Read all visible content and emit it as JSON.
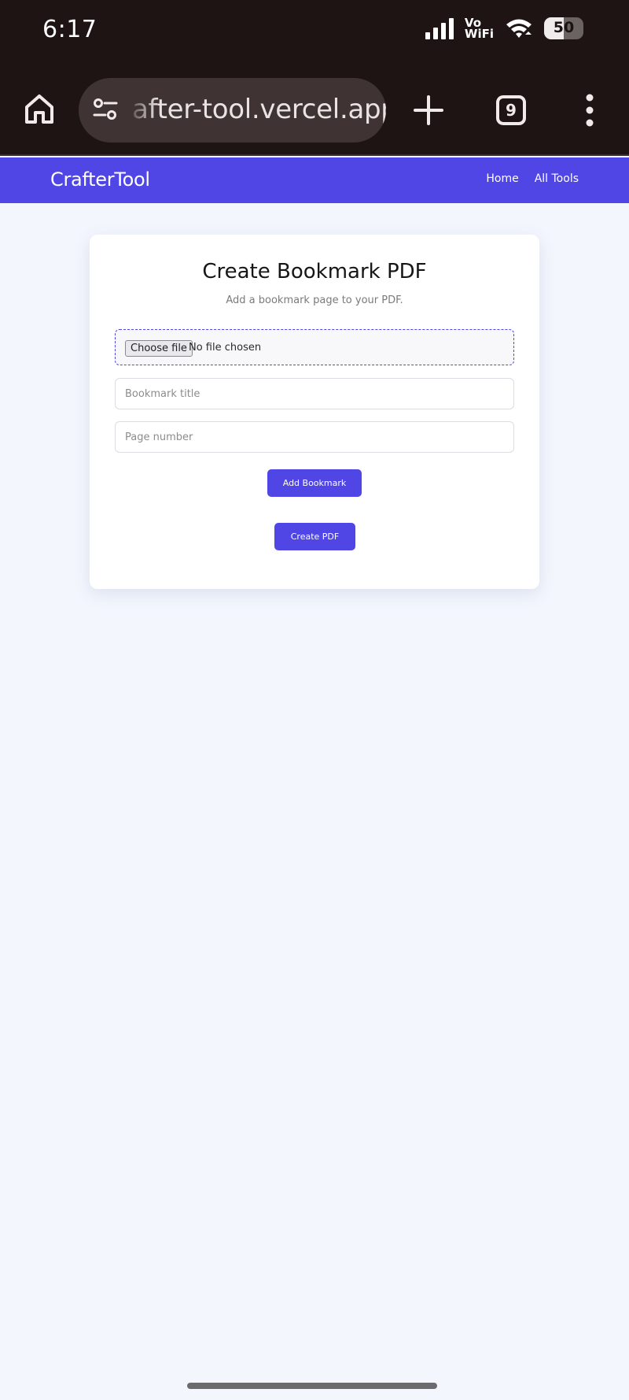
{
  "status_bar": {
    "time": "6:17",
    "vowifi_top": "Vo",
    "vowifi_bottom": "WiFi",
    "battery_level": "50",
    "icons": [
      "signal-icon",
      "vowifi-icon",
      "wifi-icon",
      "battery-icon"
    ]
  },
  "browser": {
    "url": "after-tool.vercel.app",
    "tab_count": "9",
    "icons": [
      "home-icon",
      "site-settings-icon",
      "new-tab-icon",
      "tab-switcher-icon",
      "more-vert-icon"
    ]
  },
  "nav": {
    "brand": "CrafterTool",
    "links": [
      {
        "label": "Home"
      },
      {
        "label": "All Tools"
      }
    ],
    "color": "#5046e5"
  },
  "card": {
    "title": "Create Bookmark PDF",
    "subtitle": "Add a bookmark page to your PDF.",
    "file_input": {
      "button_label": "Choose file",
      "status": "No file chosen"
    },
    "bookmark_title": {
      "value": "",
      "placeholder": "Bookmark title"
    },
    "page_number": {
      "value": "",
      "placeholder": "Page number"
    },
    "add_bookmark_label": "Add Bookmark",
    "create_pdf_label": "Create PDF"
  },
  "colors": {
    "accent": "#5046e5",
    "page_background": "#f3f6fd",
    "system_bar": "#1f1414"
  }
}
